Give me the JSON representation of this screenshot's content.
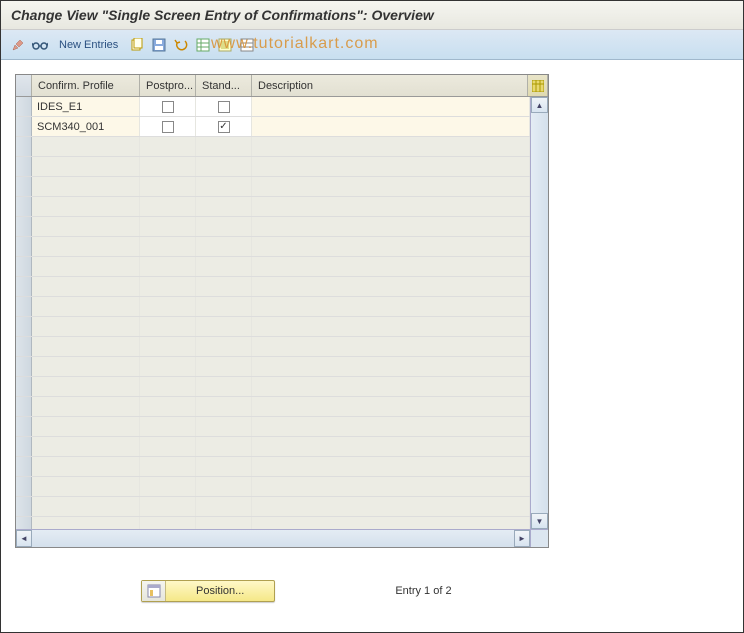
{
  "title": "Change View \"Single Screen Entry of Confirmations\": Overview",
  "watermark": "www.tutorialkart.com",
  "toolbar": {
    "new_entries": "New Entries"
  },
  "columns": {
    "c1": "Confirm. Profile",
    "c2": "Postpro...",
    "c3": "Stand...",
    "c4": "Description"
  },
  "rows": [
    {
      "profile": "IDES_E1",
      "postpro": false,
      "stand": false,
      "description": ""
    },
    {
      "profile": "SCM340_001",
      "postpro": false,
      "stand": true,
      "description": ""
    }
  ],
  "footer": {
    "position_label": "Position...",
    "entry_text": "Entry 1 of 2"
  }
}
